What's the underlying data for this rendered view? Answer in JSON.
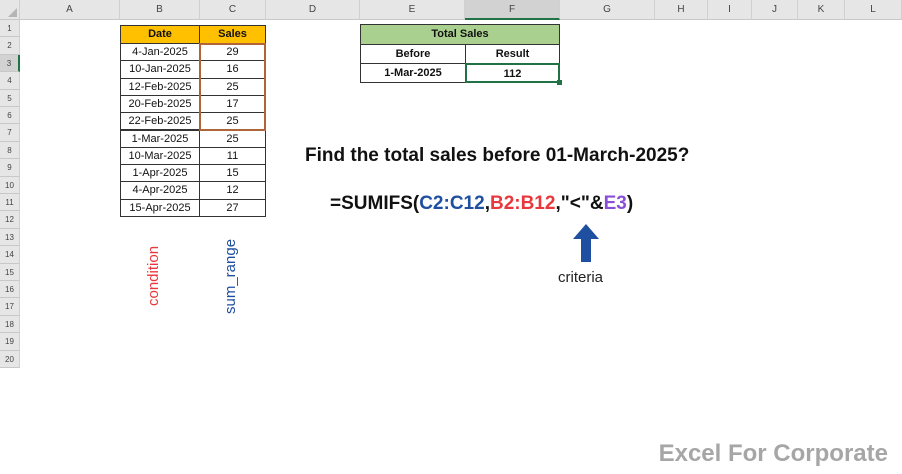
{
  "sheet": {
    "columns": [
      "A",
      "B",
      "C",
      "D",
      "E",
      "F",
      "G",
      "H",
      "I",
      "J",
      "K",
      "L"
    ],
    "rows": [
      "1",
      "2",
      "3",
      "4",
      "5",
      "6",
      "7",
      "8",
      "9",
      "10",
      "11",
      "12",
      "13",
      "14",
      "15",
      "16",
      "17",
      "18",
      "19",
      "20"
    ]
  },
  "table1": {
    "headers": [
      "Date",
      "Sales"
    ],
    "rows": [
      [
        "4-Jan-2025",
        "29"
      ],
      [
        "10-Jan-2025",
        "16"
      ],
      [
        "12-Feb-2025",
        "25"
      ],
      [
        "20-Feb-2025",
        "17"
      ],
      [
        "22-Feb-2025",
        "25"
      ],
      [
        "1-Mar-2025",
        "25"
      ],
      [
        "10-Mar-2025",
        "11"
      ],
      [
        "1-Apr-2025",
        "15"
      ],
      [
        "4-Apr-2025",
        "12"
      ],
      [
        "15-Apr-2025",
        "27"
      ]
    ]
  },
  "table2": {
    "title": "Total Sales",
    "headers": [
      "Before",
      "Result"
    ],
    "values": [
      "1-Mar-2025",
      "112"
    ]
  },
  "question": "Find the total sales before 01-March-2025?",
  "formula": {
    "prefix": "=SUMIFS(",
    "arg1": "C2:C12",
    "comma1": ",",
    "arg2": "B2:B12",
    "mid": ",\"<\"&",
    "arg3": "E3",
    "suffix": ")"
  },
  "labels": {
    "condition": "condition",
    "sum_range": "sum_range",
    "criteria": "criteria"
  },
  "watermark": "Excel For Corporate",
  "colors": {
    "header_orange": "#ffc000",
    "header_green": "#a9d08e",
    "formula_blue": "#1f4fa0",
    "formula_red": "#e8383d",
    "formula_purple": "#8a4fd8",
    "arrow_blue": "#1f4fa0",
    "highlight_border": "#b0643a",
    "selected_green": "#217346"
  },
  "icons": {
    "arrow": "arrow-up-icon"
  }
}
